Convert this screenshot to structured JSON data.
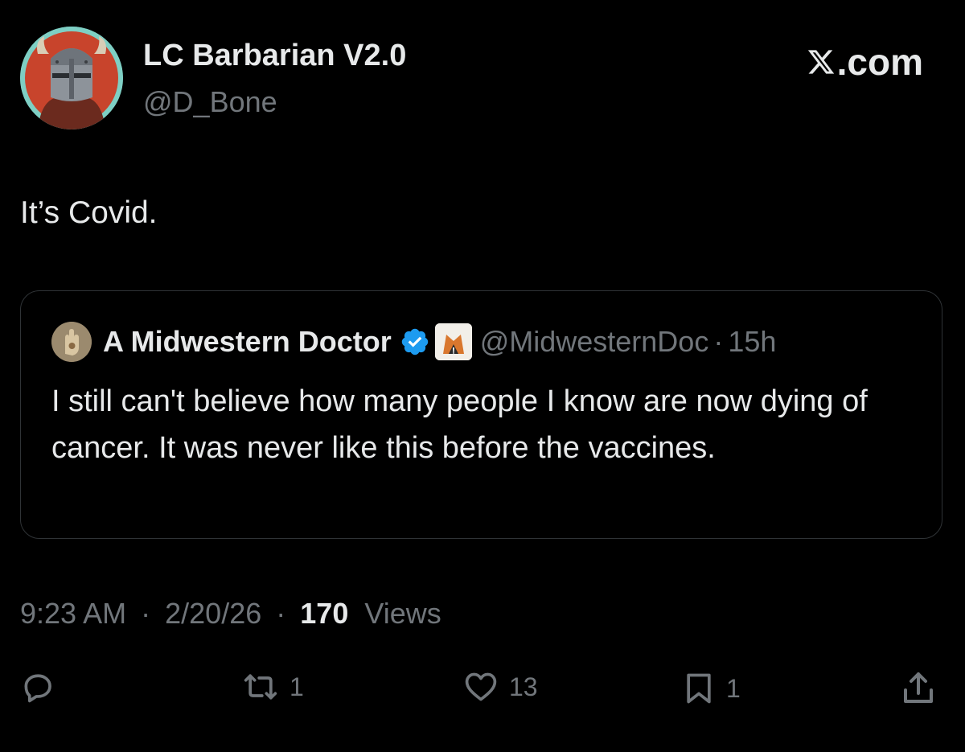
{
  "author": {
    "display_name": "LC Barbarian V2.0",
    "handle": "@D_Bone",
    "avatar_icon": "barbarian-helmet-avatar"
  },
  "brand": {
    "label": ".com"
  },
  "tweet": {
    "text": "It’s Covid."
  },
  "quote": {
    "display_name": "A Midwestern Doctor",
    "verified_icon": "verified-badge-icon",
    "handle": "@MidwesternDoc",
    "separator": "·",
    "time": "15h",
    "text": "I still can't believe how many people I know are now dying of cancer. It was never like this before the vaccines."
  },
  "meta": {
    "time": "9:23 AM",
    "separator": "·",
    "date": "2/20/26",
    "views_count": "170",
    "views_label": "Views"
  },
  "actions": {
    "reply_icon": "reply-icon",
    "repost_icon": "repost-icon",
    "repost_count": "1",
    "like_icon": "heart-icon",
    "like_count": "13",
    "bookmark_icon": "bookmark-icon",
    "bookmark_count": "1",
    "share_icon": "share-icon"
  },
  "colors": {
    "background": "#000000",
    "text": "#e7e9ea",
    "muted": "#71767b",
    "border": "#2f3336",
    "verified": "#1d9bf0"
  }
}
